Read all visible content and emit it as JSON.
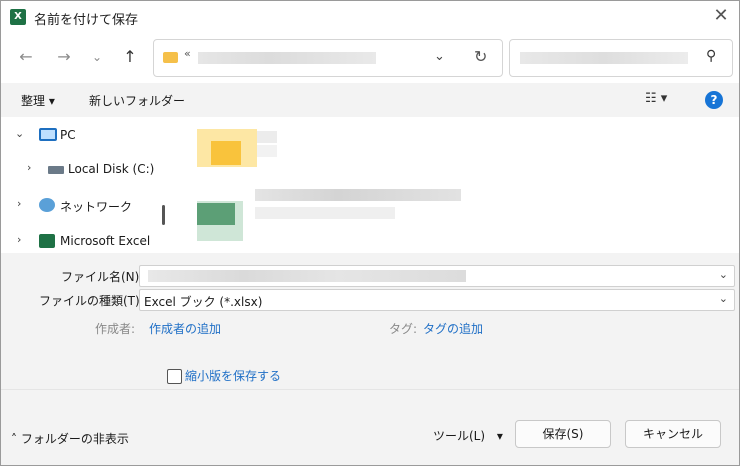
{
  "window": {
    "title": "名前を付けて保存",
    "app_icon": "excel-icon",
    "close_icon": "close-icon"
  },
  "nav": {
    "address_prefix": "«",
    "search_icon": "search-icon"
  },
  "toolbar": {
    "organize": "整理 ▾",
    "new_folder": "新しいフォルダー",
    "view_icon": "view-options-icon",
    "help": "?"
  },
  "tree": {
    "items": [
      {
        "label": "PC",
        "icon": "pc-icon",
        "expanded": true
      },
      {
        "label": "Local Disk (C:)",
        "icon": "drive-icon",
        "expanded": false
      },
      {
        "label": "ネットワーク",
        "icon": "network-icon",
        "expanded": false
      },
      {
        "label": "Microsoft Excel",
        "icon": "excel-icon",
        "expanded": false
      }
    ]
  },
  "form": {
    "filename_label": "ファイル名(N):",
    "filetype_label": "ファイルの種類(T):",
    "filetype_value": "Excel ブック (*.xlsx)",
    "author_label": "作成者:",
    "author_link": "作成者の追加",
    "tags_label": "タグ:",
    "tags_link": "タグの追加",
    "thumbnail_label": "縮小版を保存する",
    "thumbnail_checked": false
  },
  "footer": {
    "hide_folders": "フォルダーの非表示",
    "tools": "ツール(L)",
    "save": "保存(S)",
    "cancel": "キャンセル"
  },
  "colors": {
    "accent": "#1674d6",
    "link": "#1f6fc6",
    "folder": "#f5c04a",
    "excel": "#1e7145"
  }
}
